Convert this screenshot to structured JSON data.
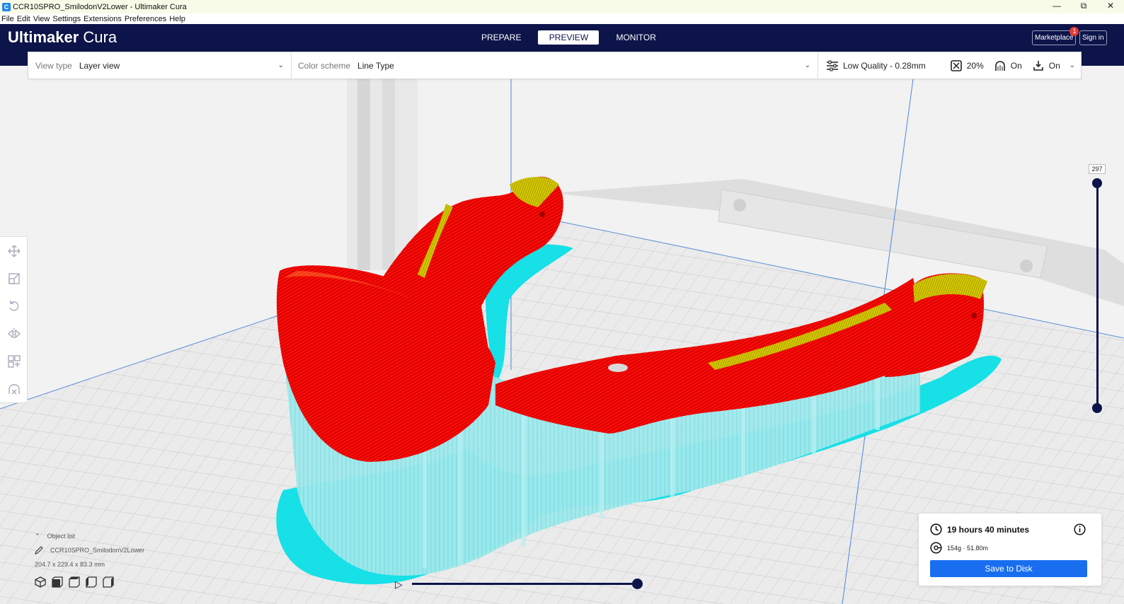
{
  "window": {
    "title": "CCR10SPRO_SmilodonV2Lower - Ultimaker Cura",
    "minimize": "—",
    "restore": "⧉",
    "close": "✕"
  },
  "menu": {
    "items": [
      "File",
      "Edit",
      "View",
      "Settings",
      "Extensions",
      "Preferences",
      "Help"
    ]
  },
  "header": {
    "brand_bold": "Ultimaker",
    "brand_light": " Cura",
    "tabs": [
      "PREPARE",
      "PREVIEW",
      "MONITOR"
    ],
    "active_tab": "PREVIEW",
    "marketplace": "Marketplace",
    "marketplace_badge": "1",
    "sign_in": "Sign in"
  },
  "toolbar": {
    "view_type_label": "View type",
    "view_type_value": "Layer view",
    "color_scheme_label": "Color scheme",
    "color_scheme_value": "Line Type",
    "quality": "Low Quality - 0.28mm",
    "infill": "20%",
    "support": "On",
    "adhesion": "On"
  },
  "left_tools": [
    "move-icon",
    "scale-icon",
    "rotate-icon",
    "mirror-icon",
    "per-model-settings-icon",
    "support-blocker-icon"
  ],
  "layer_slider": {
    "current_layer": "297"
  },
  "object_list": {
    "label": "Object list",
    "object_name": "CCR10SPRO_SmilodonV2Lower",
    "dimensions": "204.7 x 229.4 x 83.3 mm"
  },
  "print_info": {
    "time": "19 hours 40 minutes",
    "material": "154g · 51.80m",
    "save_button": "Save to Disk"
  },
  "colors": {
    "header": "#0c1449",
    "accent": "#196ef0",
    "skin": "#ff0000",
    "support": "#00e6e6",
    "top_skin": "#e6e600"
  }
}
